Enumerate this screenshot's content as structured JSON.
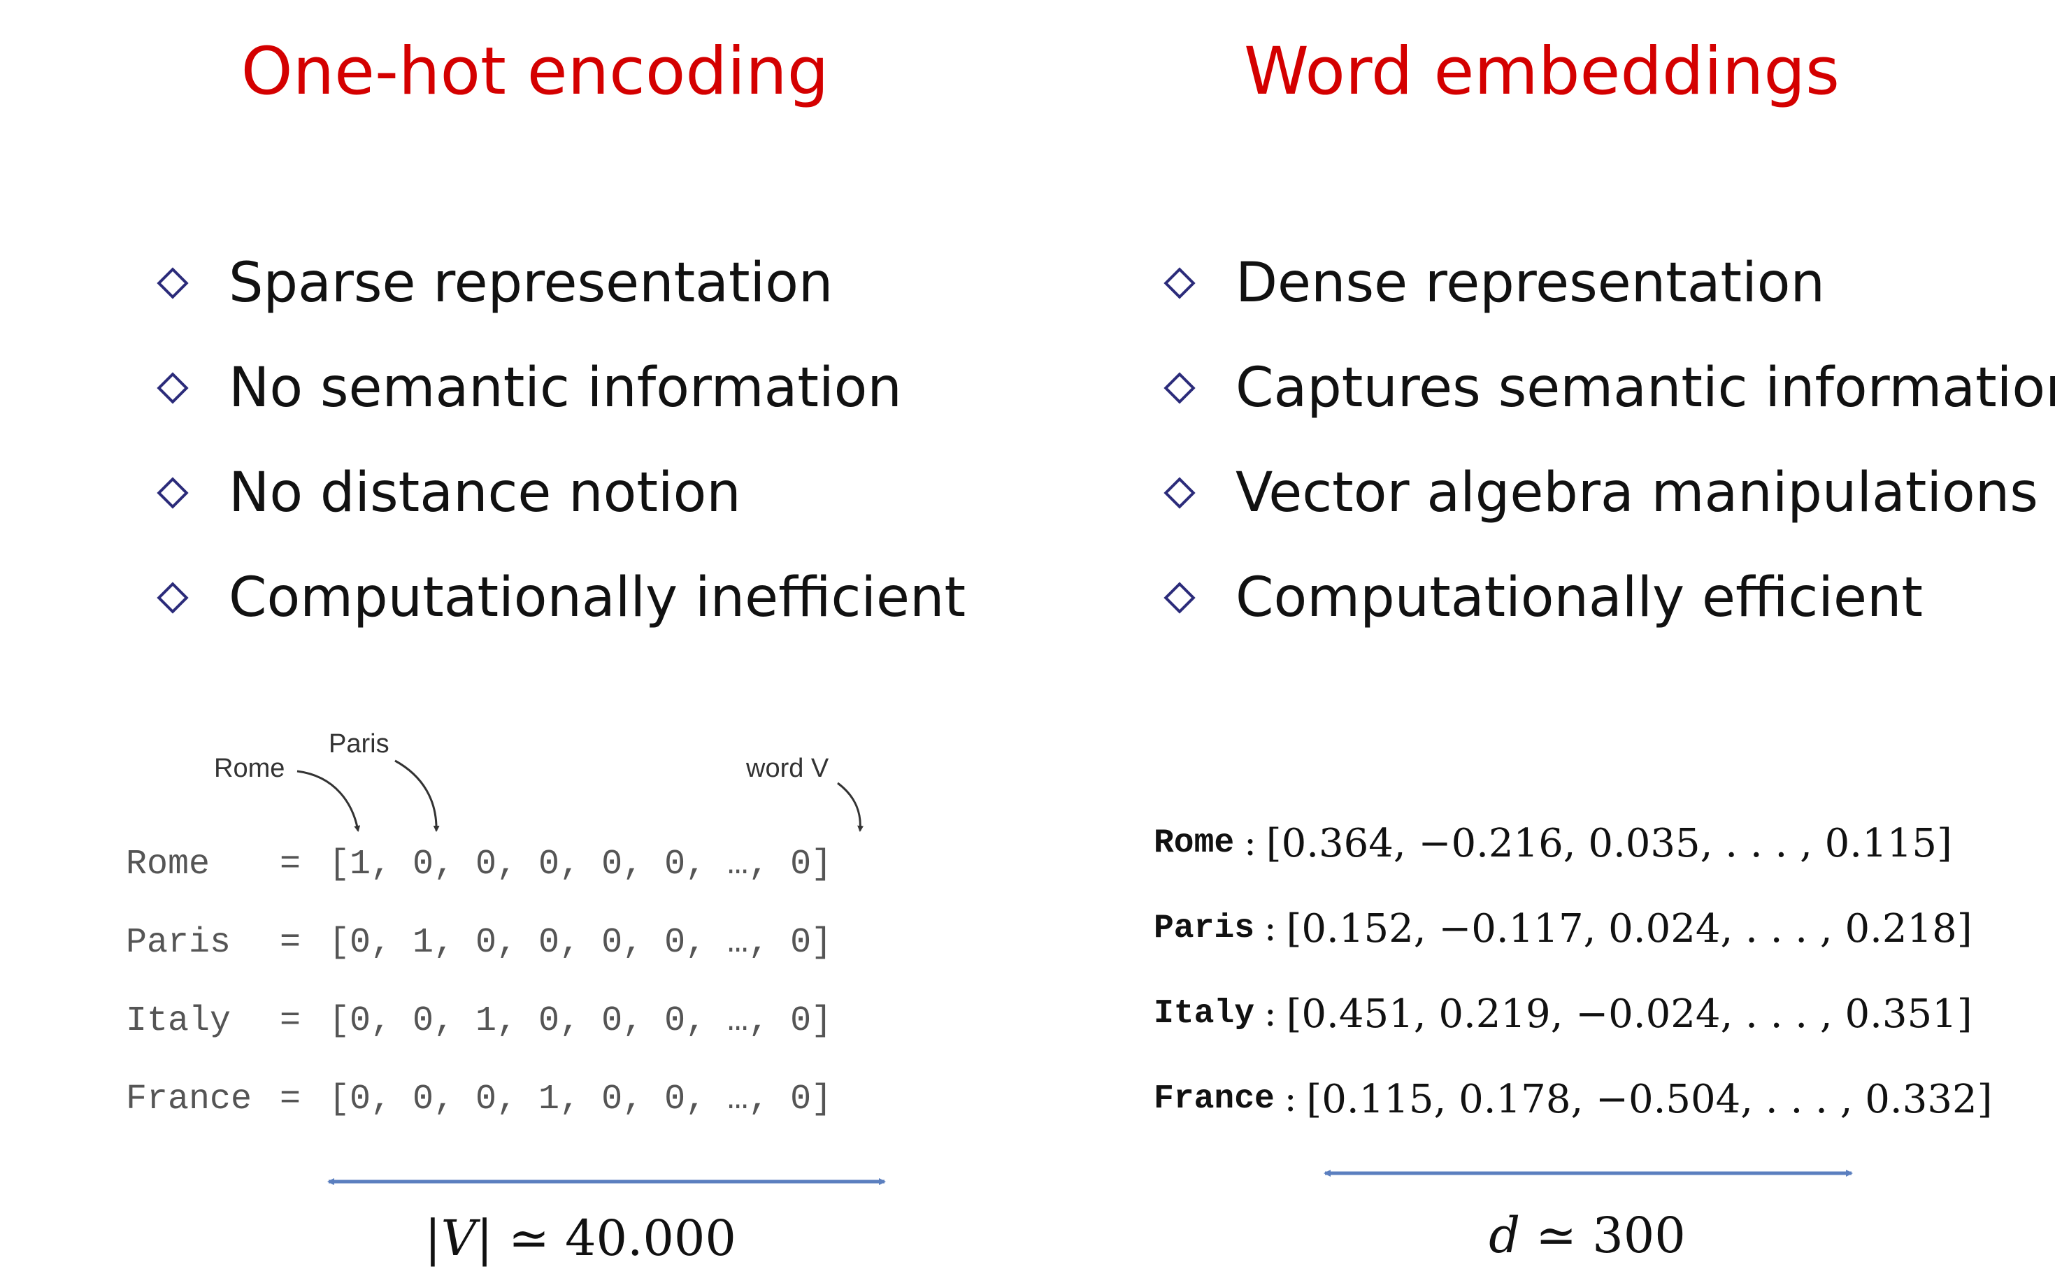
{
  "left": {
    "title": "One-hot encoding",
    "bullets": [
      "Sparse representation",
      "No semantic information",
      "No distance notion",
      "Computationally inefficient"
    ],
    "annotations": {
      "rome": "Rome",
      "paris": "Paris",
      "word_v": "word V"
    },
    "rows": [
      {
        "word": "Rome",
        "eq": "=",
        "vector": "[1, 0, 0, 0, 0, 0, …, 0]"
      },
      {
        "word": "Paris",
        "eq": "=",
        "vector": "[0, 1, 0, 0, 0, 0, …, 0]"
      },
      {
        "word": "Italy",
        "eq": "=",
        "vector": "[0, 0, 1, 0, 0, 0, …, 0]"
      },
      {
        "word": "France",
        "eq": "=",
        "vector": "[0, 0, 0, 1, 0, 0, …, 0]"
      }
    ],
    "dimension": {
      "lhs": "|V|",
      "op": "≃",
      "rhs": "40.000"
    }
  },
  "right": {
    "title": "Word embeddings",
    "bullets": [
      "Dense representation",
      "Captures semantic information",
      "Vector algebra manipulations",
      "Computationally efficient"
    ],
    "rows": [
      {
        "word": "Rome",
        "vector": "[0.364, −0.216, 0.035, . . . , 0.115]"
      },
      {
        "word": "Paris",
        "vector": "[0.152, −0.117, 0.024, . . . , 0.218]"
      },
      {
        "word": "Italy",
        "vector": "[0.451, 0.219, −0.024, . . . , 0.351]"
      },
      {
        "word": "France",
        "vector": "[0.115, 0.178, −0.504, . . . , 0.332]"
      }
    ],
    "dimension": {
      "lhs": "d",
      "op": "≃",
      "rhs": "300"
    }
  },
  "colors": {
    "title": "#d40000",
    "bullet": "#2b2b7a",
    "arrow": "#5b7fbf"
  }
}
